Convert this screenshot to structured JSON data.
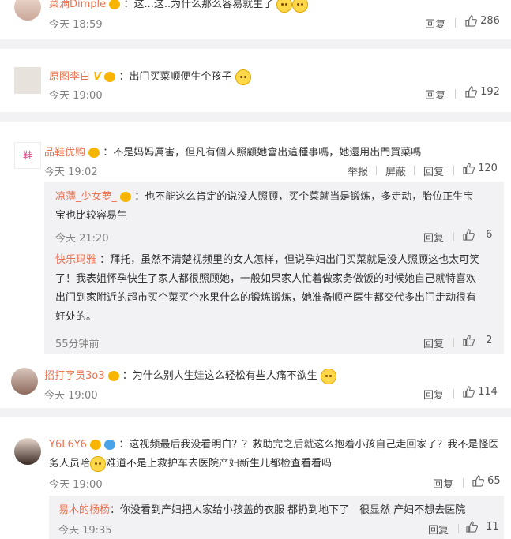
{
  "comments": [
    {
      "user": "菜满Dimple",
      "text": "：这...这..为什么那么容易就生了",
      "time": "今天 18:59",
      "reply_label": "回复",
      "likes": "286"
    },
    {
      "user": "原图李白",
      "text": "：出门买菜顺便生个孩子",
      "time": "今天 19:00",
      "reply_label": "回复",
      "likes": "192"
    },
    {
      "user": "品鞋优购",
      "text": "：不是妈妈厲害，但凡有個人照顧她會出這種事嗎，她還用出門買菜嗎",
      "time": "今天 19:02",
      "report_label": "举报",
      "block_label": "屏蔽",
      "reply_label": "回复",
      "likes": "120",
      "avatar_char": "鞋",
      "replies": [
        {
          "user": "凉薄_少女萝_",
          "line1": "：也不能这么肯定的说没人照顾，买个菜就当是锻炼，多走动，胎位正生宝",
          "line2": "宝也比较容易生",
          "time": "今天 21:20",
          "reply_label": "回复",
          "likes": "6"
        },
        {
          "user": "快乐玛雅",
          "line1": "：拜托，虽然不清楚视频里的女人怎样，但说孕妇出门买菜就是没人照顾这也太可笑",
          "line2": "了！我表姐怀孕快生了家人都很照顾她，一般如果家人忙着做家务做饭的时候她自己就特喜欢",
          "line3": "出门到家附近的超市买个菜买个水果什么的锻炼锻炼，她准备顺产医生都交代多出门走动很有",
          "line4": "好处的。",
          "time": "55分钟前",
          "reply_label": "回复",
          "likes": "2"
        }
      ]
    },
    {
      "user": "招打字员3o3",
      "text": "：为什么别人生娃这么轻松有些人痛不欲生",
      "time": "今天 19:00",
      "reply_label": "回复",
      "likes": "114"
    },
    {
      "user": "Y6L6Y6",
      "line1": "：这视频最后我没看明白？？救助完之后就这么抱着小孩自己走回家了？我不是怪医",
      "line2_a": "务人员哈",
      "line2_b": "难道不是上救护车去医院产妇新生儿都检查看看吗",
      "time": "今天 19:00",
      "reply_label": "回复",
      "likes": "65",
      "replies": [
        {
          "user": "易木的杨杨",
          "text": "：你没看到产妇把人家给小孩盖的衣服 都扔到地下了　很显然 产妇不想去医院",
          "time": "今天 19:35",
          "reply_label": "回复",
          "likes": "11"
        }
      ]
    }
  ]
}
